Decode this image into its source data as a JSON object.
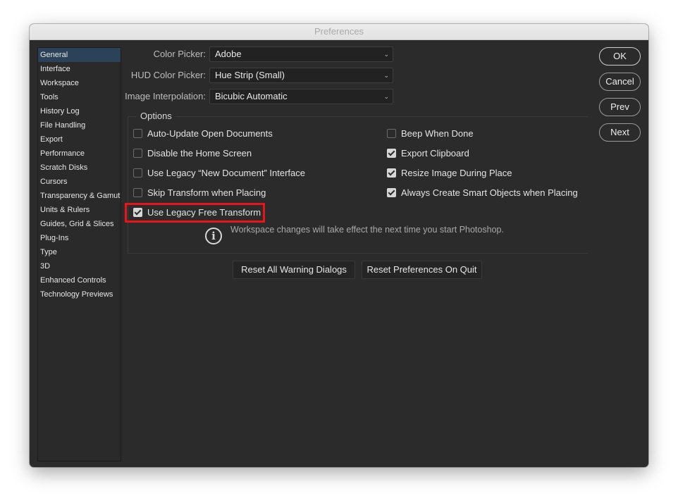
{
  "window": {
    "title": "Preferences"
  },
  "sidebar": {
    "items": [
      {
        "label": "General",
        "active": true
      },
      {
        "label": "Interface"
      },
      {
        "label": "Workspace"
      },
      {
        "label": "Tools"
      },
      {
        "label": "History Log"
      },
      {
        "label": "File Handling"
      },
      {
        "label": "Export"
      },
      {
        "label": "Performance"
      },
      {
        "label": "Scratch Disks"
      },
      {
        "label": "Cursors"
      },
      {
        "label": "Transparency & Gamut"
      },
      {
        "label": "Units & Rulers"
      },
      {
        "label": "Guides, Grid & Slices"
      },
      {
        "label": "Plug-Ins"
      },
      {
        "label": "Type"
      },
      {
        "label": "3D"
      },
      {
        "label": "Enhanced Controls"
      },
      {
        "label": "Technology Previews"
      }
    ]
  },
  "fields": {
    "color_picker": {
      "label": "Color Picker:",
      "value": "Adobe"
    },
    "hud_color_picker": {
      "label": "HUD Color Picker:",
      "value": "Hue Strip (Small)"
    },
    "image_interpolation": {
      "label": "Image Interpolation:",
      "value": "Bicubic Automatic"
    }
  },
  "options": {
    "title": "Options",
    "left": [
      {
        "label": "Auto-Update Open Documents",
        "checked": false
      },
      {
        "label": "Disable the Home Screen",
        "checked": false
      },
      {
        "label": "Use Legacy “New Document” Interface",
        "checked": false
      },
      {
        "label": "Skip Transform when Placing",
        "checked": false
      },
      {
        "label": "Use Legacy Free Transform",
        "checked": true,
        "highlighted": true
      }
    ],
    "right": [
      {
        "label": "Beep When Done",
        "checked": false
      },
      {
        "label": "Export Clipboard",
        "checked": true
      },
      {
        "label": "Resize Image During Place",
        "checked": true
      },
      {
        "label": "Always Create Smart Objects when Placing",
        "checked": true
      }
    ],
    "info_message": "Workspace changes will take effect the next time you start Photoshop.",
    "highlight_color": "#e8141a"
  },
  "actions": {
    "reset_warnings": "Reset All Warning Dialogs",
    "reset_prefs": "Reset Preferences On Quit"
  },
  "dialog_buttons": {
    "ok": "OK",
    "cancel": "Cancel",
    "prev": "Prev",
    "next": "Next"
  },
  "icons": {
    "chevron": "⌄",
    "info": "i"
  }
}
